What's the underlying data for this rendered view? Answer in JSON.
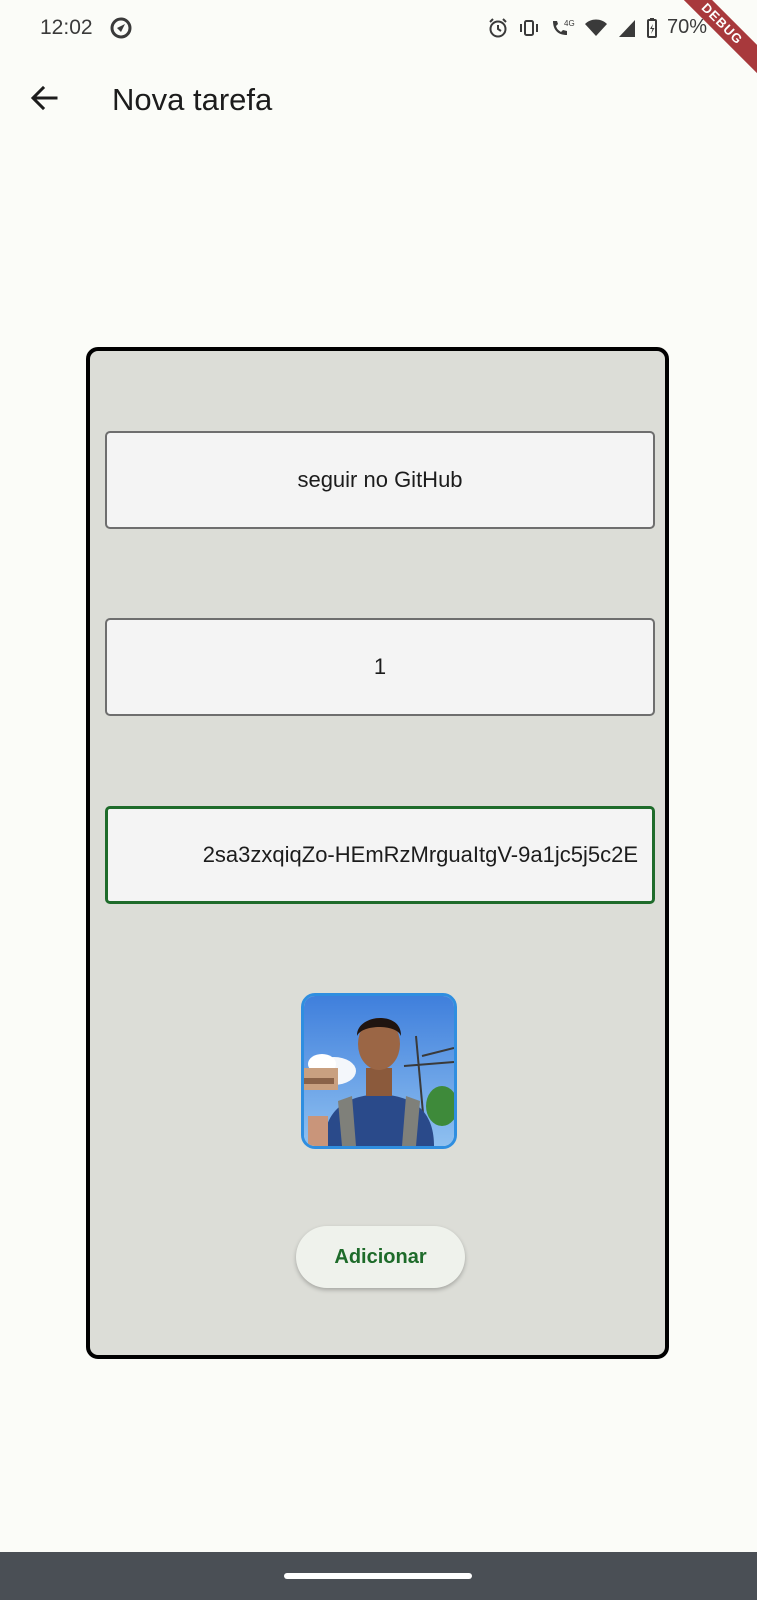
{
  "status_bar": {
    "time": "12:02",
    "battery": "70",
    "icons": [
      "app-notification-icon",
      "alarm-icon",
      "vibrate-icon",
      "volte-4g-call-icon",
      "wifi-icon",
      "signal-icon",
      "battery-icon"
    ]
  },
  "debug_banner": "DEBUG",
  "app_bar": {
    "title": "Nova tarefa",
    "back_icon": "arrow-back-icon"
  },
  "form": {
    "name_value": "seguir no GitHub",
    "difficulty_value": "1",
    "image_url_value": "2sa3zxqiqZo-HEmRzMrguaItgV-9a1jc5j5c2E",
    "photo": "person-photo",
    "submit_label": "Adicionar"
  },
  "colors": {
    "background": "#fbfcf8",
    "card": "#dcddd7",
    "field": "#f4f4f4",
    "focus_border": "#1e6b2a",
    "photo_border": "#2f8ee0",
    "button_text": "#1e6b2a",
    "nav_bar": "#4a4f55"
  }
}
